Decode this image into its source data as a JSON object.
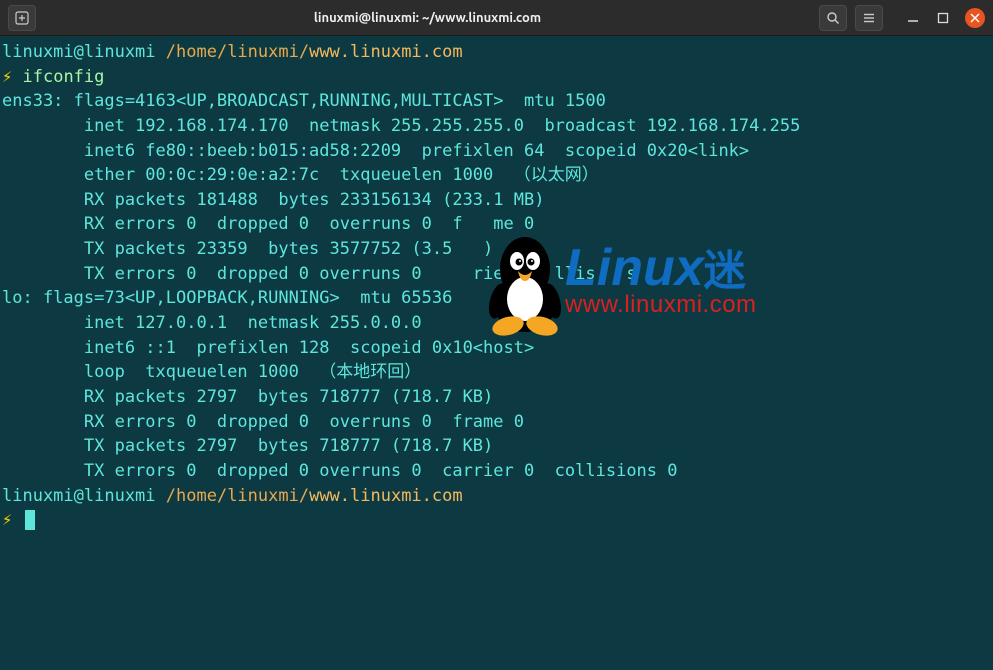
{
  "titlebar": {
    "title": "linuxmi@linuxmi: ~/www.linuxmi.com"
  },
  "prompt1": {
    "user": "linuxmi@linuxmi",
    "path": "/home/linuxmi/",
    "path2": "www.linuxmi.com",
    "bolt": "⚡",
    "cmd": "ifconfig"
  },
  "output": {
    "l1": "ens33: flags=4163<UP,BROADCAST,RUNNING,MULTICAST>  mtu 1500",
    "l2": "        inet 192.168.174.170  netmask 255.255.255.0  broadcast 192.168.174.255",
    "l3": "        inet6 fe80::beeb:b015:ad58:2209  prefixlen 64  scopeid 0x20<link>",
    "l4": "        ether 00:0c:29:0e:a2:7c  txqueuelen 1000  （以太网）",
    "l5": "        RX packets 181488  bytes 233156134 (233.1 MB)",
    "l6": "        RX errors 0  dropped 0  overruns 0  f   me 0",
    "l7": "        TX packets 23359  bytes 3577752 (3.5   )",
    "l8": "        TX errors 0  dropped 0 overruns 0     rie     llis   s",
    "l9": "",
    "l10": "lo: flags=73<UP,LOOPBACK,RUNNING>  mtu 65536",
    "l11": "        inet 127.0.0.1  netmask 255.0.0.0",
    "l12": "        inet6 ::1  prefixlen 128  scopeid 0x10<host>",
    "l13": "        loop  txqueuelen 1000  （本地环回）",
    "l14": "        RX packets 2797  bytes 718777 (718.7 KB)",
    "l15": "        RX errors 0  dropped 0  overruns 0  frame 0",
    "l16": "        TX packets 2797  bytes 718777 (718.7 KB)",
    "l17": "        TX errors 0  dropped 0 overruns 0  carrier 0  collisions 0",
    "l18": ""
  },
  "prompt2": {
    "user": "linuxmi@linuxmi",
    "path": "/home/linuxmi/",
    "path2": "www.linuxmi.com",
    "bolt": "⚡"
  },
  "watermark": {
    "brand": "Linux",
    "suffix": "迷",
    "url": "www.linuxmi.com"
  }
}
